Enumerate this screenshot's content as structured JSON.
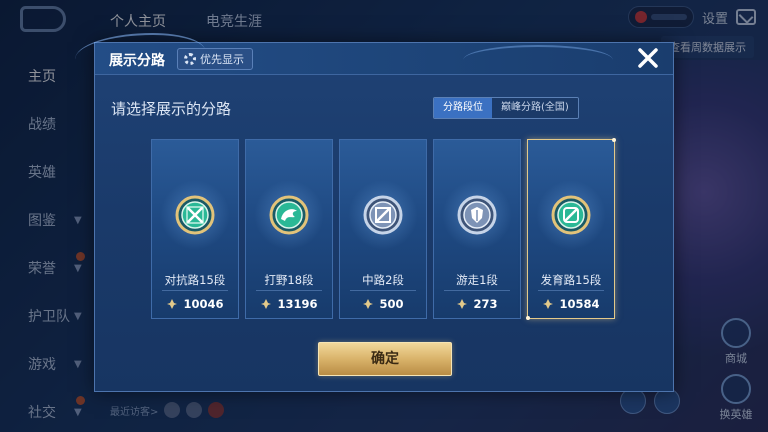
{
  "background": {
    "top_tabs": [
      "个人主页",
      "电竞生涯"
    ],
    "settings_label": "设置",
    "right_banner": "查看周数据展示",
    "sidebar": [
      {
        "label": "主页",
        "active": true
      },
      {
        "label": "战绩"
      },
      {
        "label": "英雄"
      },
      {
        "label": "图鉴",
        "has_chevron": true
      },
      {
        "label": "荣誉",
        "has_chevron": true
      },
      {
        "label": "护卫队",
        "has_chevron": true
      },
      {
        "label": "游戏",
        "has_chevron": true
      },
      {
        "label": "社交",
        "has_chevron": true
      }
    ],
    "visitors_label": "最近访客>",
    "right_buttons": [
      "商城",
      "换英雄"
    ]
  },
  "modal": {
    "title": "展示分路",
    "priority_label": "优先显示",
    "subtitle": "请选择展示的分路",
    "toggle": [
      {
        "label": "分路段位",
        "active": true
      },
      {
        "label": "巅峰分路(全国)",
        "active": false
      }
    ],
    "cards": [
      {
        "label": "对抗路15段",
        "points": "10046",
        "emblem": "crossed-swords-icon",
        "selected": false
      },
      {
        "label": "打野18段",
        "points": "13196",
        "emblem": "dragon-icon",
        "selected": false
      },
      {
        "label": "中路2段",
        "points": "500",
        "emblem": "staff-icon",
        "selected": false
      },
      {
        "label": "游走1段",
        "points": "273",
        "emblem": "shield-wings-icon",
        "selected": false
      },
      {
        "label": "发育路15段",
        "points": "10584",
        "emblem": "bow-target-icon",
        "selected": true
      }
    ],
    "confirm_label": "确定"
  },
  "colors": {
    "accent_blue": "#3b71c2",
    "gold_button": "#d9b36a",
    "selected_border": "#e3c98a",
    "emblem_green": "#3cc8a0",
    "emblem_silver": "#c6d4e8"
  }
}
